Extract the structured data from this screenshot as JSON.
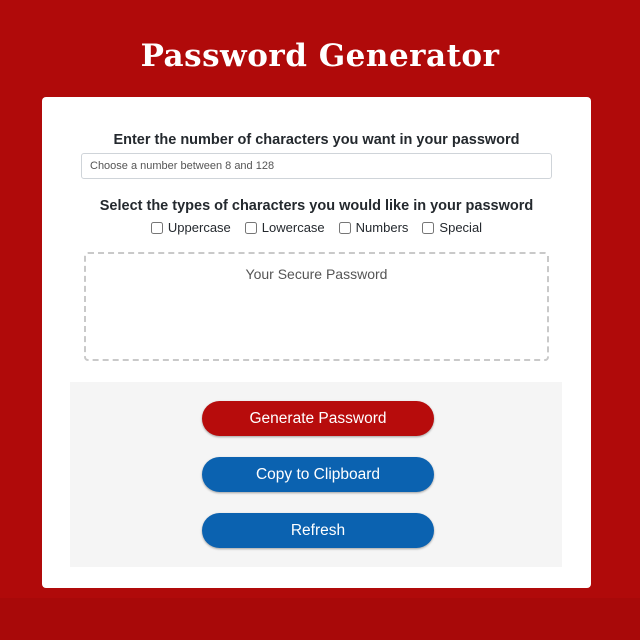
{
  "page": {
    "title": "Password Generator"
  },
  "form": {
    "length_label": "Enter the number of characters you want in your password",
    "length_placeholder": "Choose a number between 8 and 128",
    "types_label": "Select the types of characters you would like in your password",
    "checkboxes": [
      {
        "label": "Uppercase",
        "checked": false
      },
      {
        "label": "Lowercase",
        "checked": false
      },
      {
        "label": "Numbers",
        "checked": false
      },
      {
        "label": "Special",
        "checked": false
      }
    ],
    "output_placeholder": "Your Secure Password"
  },
  "actions": {
    "generate_label": "Generate Password",
    "copy_label": "Copy to Clipboard",
    "refresh_label": "Refresh"
  },
  "colors": {
    "background": "#b00a0a",
    "generate_button": "#b70c0c",
    "secondary_button": "#0b62b0"
  }
}
